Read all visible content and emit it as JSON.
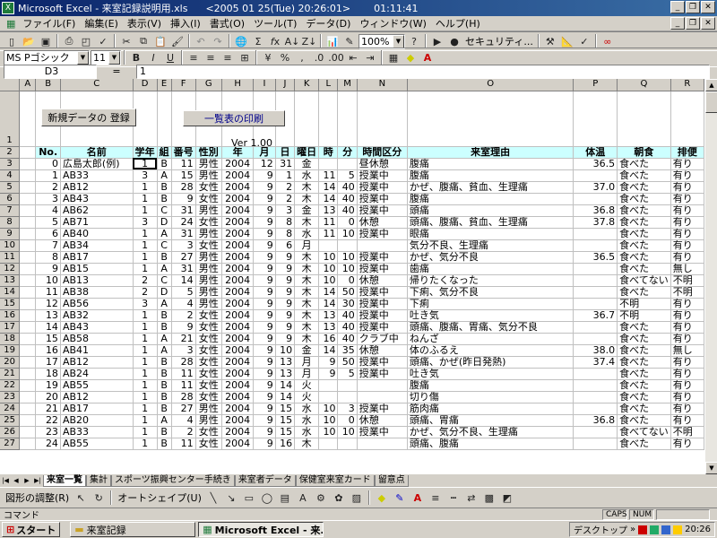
{
  "window": {
    "title": "Microsoft Excel - 来室記録説明用.xls",
    "datetime": "<2005 01 25(Tue) 20:26:01>",
    "clock2": "01:11:41"
  },
  "menu": [
    "ファイル(F)",
    "編集(E)",
    "表示(V)",
    "挿入(I)",
    "書式(O)",
    "ツール(T)",
    "データ(D)",
    "ウィンドウ(W)",
    "ヘルプ(H)"
  ],
  "toolbar": {
    "zoom": "100%",
    "security": "セキュリティ..."
  },
  "format": {
    "font": "MS Pゴシック",
    "size": "11"
  },
  "formula": {
    "cell_ref": "D3",
    "eq": "=",
    "value": "1"
  },
  "buttons": {
    "new_data": "新規データの 登録",
    "print_list": "一覧表の印刷"
  },
  "version": "Ver 1.00",
  "columns": [
    "A",
    "B",
    "C",
    "D",
    "E",
    "F",
    "G",
    "H",
    "I",
    "J",
    "K",
    "L",
    "M",
    "N",
    "O",
    "P",
    "Q",
    "R"
  ],
  "headers": [
    "No.",
    "名前",
    "学年",
    "組",
    "番号",
    "性別",
    "年",
    "月",
    "日",
    "曜日",
    "時",
    "分",
    "時間区分",
    "来室理由",
    "体温",
    "朝食",
    "排便"
  ],
  "rows": [
    [
      "0",
      "広島太郎(例)",
      "1",
      "B",
      "11",
      "男性",
      "2004",
      "12",
      "31",
      "金",
      "",
      "",
      "昼休憩",
      "腹痛",
      "36.5",
      "食べた",
      "有り"
    ],
    [
      "1",
      "AB33",
      "3",
      "A",
      "15",
      "男性",
      "2004",
      "9",
      "1",
      "水",
      "11",
      "5",
      "授業中",
      "腹痛",
      "",
      "食べた",
      "有り"
    ],
    [
      "2",
      "AB12",
      "1",
      "B",
      "28",
      "女性",
      "2004",
      "9",
      "2",
      "木",
      "14",
      "40",
      "授業中",
      "かぜ、腹痛、貧血、生理痛",
      "37.0",
      "食べた",
      "有り"
    ],
    [
      "3",
      "AB43",
      "1",
      "B",
      "9",
      "女性",
      "2004",
      "9",
      "2",
      "木",
      "14",
      "40",
      "授業中",
      "腹痛",
      "",
      "食べた",
      "有り"
    ],
    [
      "4",
      "AB62",
      "1",
      "C",
      "31",
      "男性",
      "2004",
      "9",
      "3",
      "金",
      "13",
      "40",
      "授業中",
      "頭痛",
      "36.8",
      "食べた",
      "有り"
    ],
    [
      "5",
      "AB71",
      "3",
      "D",
      "24",
      "女性",
      "2004",
      "9",
      "8",
      "木",
      "11",
      "0",
      "休憩",
      "頭痛、腹痛、貧血、生理痛",
      "37.8",
      "食べた",
      "有り"
    ],
    [
      "6",
      "AB40",
      "1",
      "A",
      "31",
      "男性",
      "2004",
      "9",
      "8",
      "水",
      "11",
      "10",
      "授業中",
      "眼痛",
      "",
      "食べた",
      "有り"
    ],
    [
      "7",
      "AB34",
      "1",
      "C",
      "3",
      "女性",
      "2004",
      "9",
      "6",
      "月",
      "",
      "",
      "",
      "気分不良、生理痛",
      "",
      "食べた",
      "有り"
    ],
    [
      "8",
      "AB17",
      "1",
      "B",
      "27",
      "男性",
      "2004",
      "9",
      "9",
      "木",
      "10",
      "10",
      "授業中",
      "かぜ、気分不良",
      "36.5",
      "食べた",
      "有り"
    ],
    [
      "9",
      "AB15",
      "1",
      "A",
      "31",
      "男性",
      "2004",
      "9",
      "9",
      "木",
      "10",
      "10",
      "授業中",
      "歯痛",
      "",
      "食べた",
      "無し"
    ],
    [
      "10",
      "AB13",
      "2",
      "C",
      "14",
      "男性",
      "2004",
      "9",
      "9",
      "木",
      "10",
      "0",
      "休憩",
      "帰りたくなった",
      "",
      "食べてない",
      "不明"
    ],
    [
      "11",
      "AB38",
      "2",
      "D",
      "5",
      "男性",
      "2004",
      "9",
      "9",
      "木",
      "14",
      "50",
      "授業中",
      "下痢、気分不良",
      "",
      "食べた",
      "不明"
    ],
    [
      "12",
      "AB56",
      "3",
      "A",
      "4",
      "男性",
      "2004",
      "9",
      "9",
      "木",
      "14",
      "30",
      "授業中",
      "下痢",
      "",
      "不明",
      "有り"
    ],
    [
      "13",
      "AB32",
      "1",
      "B",
      "2",
      "女性",
      "2004",
      "9",
      "9",
      "木",
      "13",
      "40",
      "授業中",
      "吐き気",
      "36.7",
      "不明",
      "有り"
    ],
    [
      "14",
      "AB43",
      "1",
      "B",
      "9",
      "女性",
      "2004",
      "9",
      "9",
      "木",
      "13",
      "40",
      "授業中",
      "頭痛、腹痛、胃痛、気分不良",
      "",
      "食べた",
      "有り"
    ],
    [
      "15",
      "AB58",
      "1",
      "A",
      "21",
      "女性",
      "2004",
      "9",
      "9",
      "木",
      "16",
      "40",
      "クラブ中",
      "ねんざ",
      "",
      "食べた",
      "有り"
    ],
    [
      "16",
      "AB41",
      "1",
      "A",
      "3",
      "女性",
      "2004",
      "9",
      "10",
      "金",
      "14",
      "35",
      "休憩",
      "体のふるえ",
      "38.0",
      "食べた",
      "無し"
    ],
    [
      "17",
      "AB12",
      "1",
      "B",
      "28",
      "女性",
      "2004",
      "9",
      "13",
      "月",
      "9",
      "50",
      "授業中",
      "頭痛、かぜ(昨日発熱)",
      "37.4",
      "食べた",
      "有り"
    ],
    [
      "18",
      "AB24",
      "1",
      "B",
      "11",
      "女性",
      "2004",
      "9",
      "13",
      "月",
      "9",
      "5",
      "授業中",
      "吐き気",
      "",
      "食べた",
      "有り"
    ],
    [
      "19",
      "AB55",
      "1",
      "B",
      "11",
      "女性",
      "2004",
      "9",
      "14",
      "火",
      "",
      "",
      "",
      "腹痛",
      "",
      "食べた",
      "有り"
    ],
    [
      "20",
      "AB12",
      "1",
      "B",
      "28",
      "女性",
      "2004",
      "9",
      "14",
      "火",
      "",
      "",
      "",
      "切り傷",
      "",
      "食べた",
      "有り"
    ],
    [
      "21",
      "AB17",
      "1",
      "B",
      "27",
      "男性",
      "2004",
      "9",
      "15",
      "水",
      "10",
      "3",
      "授業中",
      "筋肉痛",
      "",
      "食べた",
      "有り"
    ],
    [
      "22",
      "AB20",
      "1",
      "A",
      "4",
      "男性",
      "2004",
      "9",
      "15",
      "水",
      "10",
      "0",
      "休憩",
      "頭痛、胃痛",
      "36.8",
      "食べた",
      "有り"
    ],
    [
      "23",
      "AB33",
      "1",
      "B",
      "2",
      "女性",
      "2004",
      "9",
      "15",
      "水",
      "10",
      "10",
      "授業中",
      "かぜ、気分不良、生理痛",
      "",
      "食べてない",
      "不明"
    ],
    [
      "24",
      "AB55",
      "1",
      "B",
      "11",
      "女性",
      "2004",
      "9",
      "16",
      "木",
      "",
      "",
      "",
      "頭痛、腹痛",
      "",
      "食べた",
      "有り"
    ]
  ],
  "tabs": [
    "来室一覧",
    "集計",
    "スポーツ振興センター手続き",
    "来室者データ",
    "保健室来室カード",
    "留意点"
  ],
  "drawing": {
    "adjust": "図形の調整(R)",
    "autoshape": "オートシェイプ(U)"
  },
  "status": {
    "mode": "コマンド",
    "caps": "CAPS",
    "num": "NUM"
  },
  "taskbar": {
    "start": "スタート",
    "task1": "来室記録",
    "task2": "Microsoft Excel - 来...",
    "desktop": "デスクトップ",
    "clock": "20:26"
  }
}
